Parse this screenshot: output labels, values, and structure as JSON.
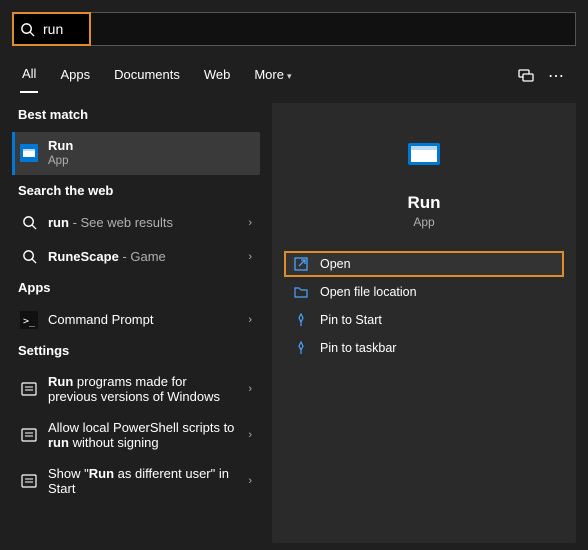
{
  "search": {
    "query": "run"
  },
  "tabs": [
    "All",
    "Apps",
    "Documents",
    "Web",
    "More"
  ],
  "tabs_active_index": 0,
  "left": {
    "best_match_label": "Best match",
    "best_match": {
      "title": "Run",
      "sub": "App"
    },
    "web_label": "Search the web",
    "web": [
      {
        "title": "run",
        "sub": " - See web results"
      },
      {
        "title": "RuneScape",
        "sub": " - Game"
      }
    ],
    "apps_label": "Apps",
    "apps": [
      {
        "title": "Command Prompt"
      }
    ],
    "settings_label": "Settings",
    "settings": [
      {
        "prefix": "Run",
        "rest": " programs made for previous versions of Windows"
      },
      {
        "prefix_mid": "run",
        "before": "Allow local PowerShell scripts to ",
        "after": " without signing"
      },
      {
        "before": "Show \"",
        "prefix": "Run",
        "after": " as different user\" in Start"
      }
    ]
  },
  "right": {
    "title": "Run",
    "type": "App",
    "actions": [
      "Open",
      "Open file location",
      "Pin to Start",
      "Pin to taskbar"
    ],
    "highlighted_action_index": 0
  }
}
